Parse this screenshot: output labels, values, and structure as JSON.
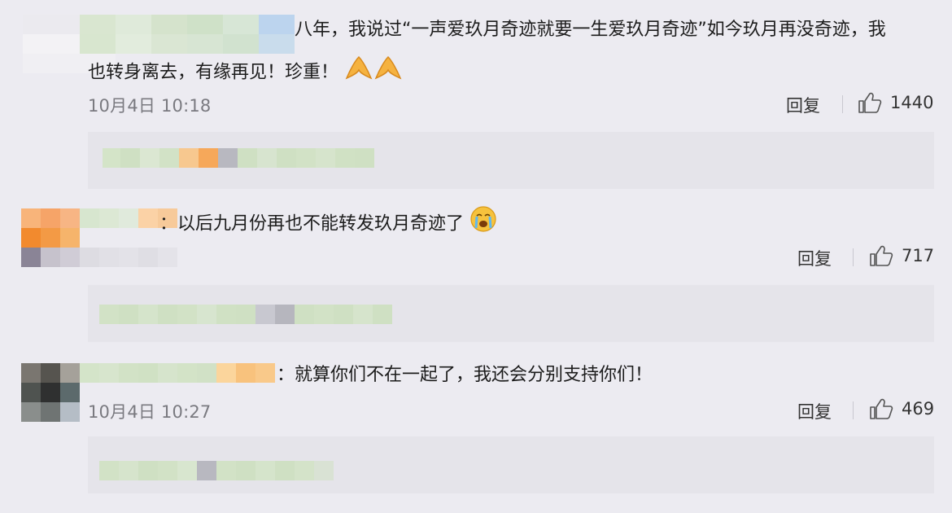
{
  "comments": [
    {
      "text_line1": "八年，我说过“一声爱玖月奇迹就要一生爱玖月奇迹”如今玖月再没奇迹，我",
      "text_line2": "也转身离去，有缘再见！珍重！",
      "emoji": "pray-hands-emoji",
      "time": "10月4日 10:18",
      "reply": "回复",
      "likes": "1440"
    },
    {
      "text_line1": "：以后九月份再也不能转发玖月奇迹了",
      "emoji": "crying-face-emoji",
      "time": "",
      "reply": "回复",
      "likes": "717"
    },
    {
      "text_line1": "：就算你们不在一起了，我还会分别支持你们！",
      "time": "10月4日 10:27",
      "reply": "回复",
      "likes": "469"
    }
  ],
  "colors": {
    "background": "#ecebf1",
    "reply_box": "#e5e4ea",
    "mosaic_green": "#cfe0c3",
    "mosaic_orange": "#f6a85a",
    "mosaic_gray": "#b8b8c0"
  }
}
